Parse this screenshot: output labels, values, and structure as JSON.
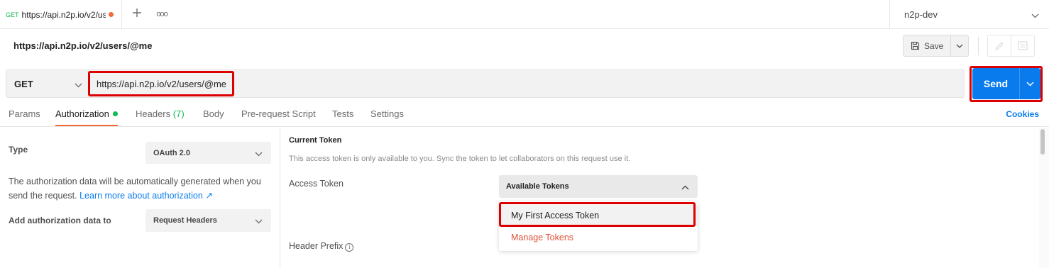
{
  "tab": {
    "method": "GET",
    "title": "https://api.n2p.io/v2/users/@me",
    "more_label": "ooo"
  },
  "environment": {
    "selected": "n2p-dev"
  },
  "request": {
    "name": "https://api.n2p.io/v2/users/@me",
    "save_label": "Save",
    "method": "GET",
    "url": "https://api.n2p.io/v2/users/@me",
    "send_label": "Send"
  },
  "request_tabs": {
    "params": "Params",
    "authorization": "Authorization",
    "headers": "Headers",
    "headers_count": "(7)",
    "body": "Body",
    "prerequest": "Pre-request Script",
    "tests": "Tests",
    "settings": "Settings",
    "cookies": "Cookies"
  },
  "auth": {
    "type_label": "Type",
    "type_value": "OAuth 2.0",
    "description": "The authorization data will be automatically generated when you send the request.",
    "learn_more": "Learn more about authorization",
    "learn_more_arrow": "↗",
    "add_to_label": "Add authorization data to",
    "add_to_value": "Request Headers"
  },
  "token": {
    "section_title": "Current Token",
    "section_note": "This access token is only available to you. Sync the token to let collaborators on this request use it.",
    "access_token_label": "Access Token",
    "select_label": "Available Tokens",
    "menu_items": [
      "My First Access Token",
      "Manage Tokens"
    ],
    "header_prefix_label": "Header Prefix",
    "info_glyph": "i"
  },
  "colors": {
    "accent_blue": "#097bed",
    "accent_orange": "#f26b3a",
    "status_green": "#0cbb52",
    "highlight_red": "#dd0000"
  }
}
